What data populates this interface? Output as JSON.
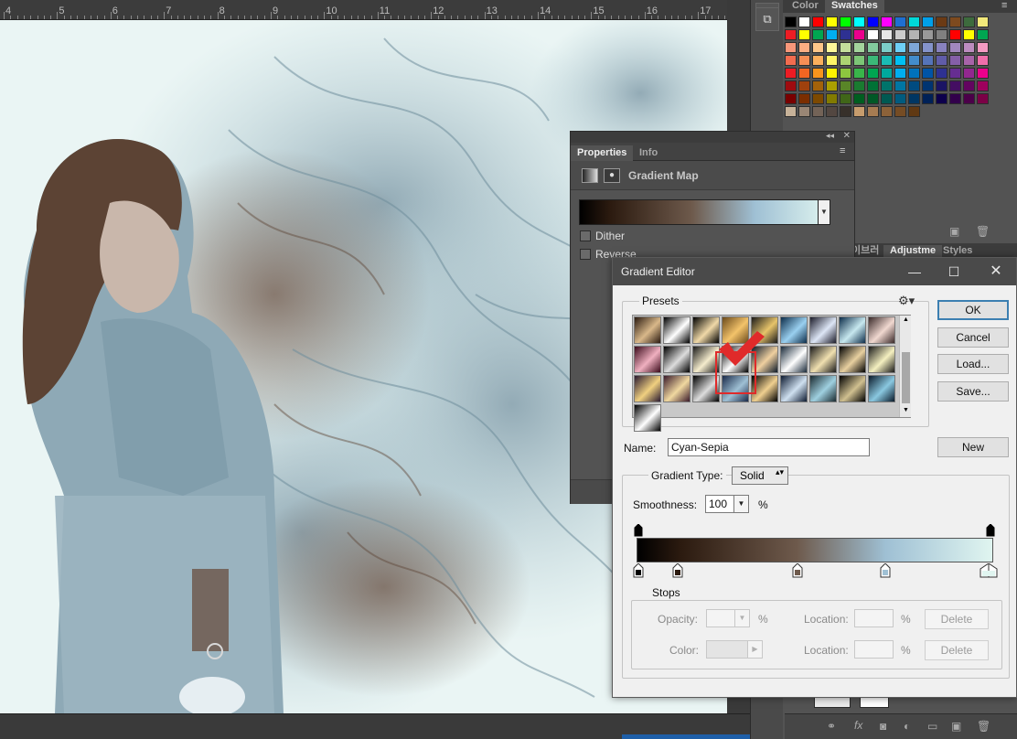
{
  "ruler": {
    "labels": [
      "4",
      "5",
      "6",
      "7",
      "8",
      "9",
      "10",
      "11",
      "12",
      "13",
      "14",
      "15",
      "16",
      "17"
    ]
  },
  "swatches_panel": {
    "tabs": [
      "Color",
      "Swatches"
    ],
    "colors": [
      "#000000",
      "#ffffff",
      "#ff0000",
      "#ffff00",
      "#00ff00",
      "#00ffff",
      "#0000ff",
      "#ff00ff",
      "#1f6fd1",
      "#00d8d8",
      "#00a0e9",
      "#6b3a14",
      "#7d4a1e",
      "#3d6b3d",
      "#f2e87a",
      "#ed1c24",
      "#ffff00",
      "#00a651",
      "#00aeef",
      "#2e3192",
      "#ec008c",
      "#ffffff",
      "#e6e6e6",
      "#cccccc",
      "#b3b3b3",
      "#999999",
      "#808080",
      "#ff0000",
      "#ffff00",
      "#00a651",
      "#f7977a",
      "#fbad82",
      "#fdc689",
      "#fff799",
      "#c4df9b",
      "#a3d39c",
      "#82ca9d",
      "#7bcdc8",
      "#6ecff6",
      "#7ea7d8",
      "#8493ca",
      "#8882be",
      "#a187be",
      "#bc8cbf",
      "#f49ac2",
      "#f26c4f",
      "#f68e55",
      "#fbaf5c",
      "#fff467",
      "#acd372",
      "#7cc576",
      "#3bb878",
      "#1abbb4",
      "#00bff3",
      "#438ccb",
      "#5574b9",
      "#605ca8",
      "#855fa8",
      "#a763a8",
      "#f06eaa",
      "#ed1c24",
      "#f26522",
      "#f7941d",
      "#fff200",
      "#8dc73f",
      "#39b54a",
      "#00a651",
      "#00a99d",
      "#00aeef",
      "#0072bc",
      "#0054a6",
      "#2e3192",
      "#662d91",
      "#92278f",
      "#ec008c",
      "#9e0b0f",
      "#a0410d",
      "#a3620a",
      "#aba000",
      "#598527",
      "#1a7b30",
      "#007236",
      "#00746b",
      "#0076a3",
      "#004b80",
      "#003471",
      "#1b1464",
      "#440e62",
      "#630460",
      "#9e005d",
      "#790000",
      "#7b2e00",
      "#7d4900",
      "#827b00",
      "#406618",
      "#005e20",
      "#005826",
      "#005952",
      "#005b7f",
      "#003663",
      "#002157",
      "#0d004c",
      "#32004b",
      "#4b0049",
      "#7b0046",
      "#c7b299",
      "#998675",
      "#736357",
      "#534741",
      "#37302a",
      "#c69c6d",
      "#a67c52",
      "#8c6239",
      "#754c24",
      "#603913"
    ]
  },
  "layers_panel": {
    "tabs": [
      "이브러",
      "Adjustme",
      "Styles"
    ]
  },
  "properties": {
    "tabs": [
      "Properties",
      "Info"
    ],
    "title": "Gradient Map",
    "dither_label": "Dither",
    "reverse_label": "Reverse"
  },
  "gradient_editor": {
    "title": "Gradient Editor",
    "presets_label": "Presets",
    "buttons": {
      "ok": "OK",
      "cancel": "Cancel",
      "load": "Load...",
      "save": "Save...",
      "new": "New"
    },
    "name_label": "Name:",
    "name_value": "Cyan-Sepia",
    "gradient_type_label": "Gradient Type:",
    "gradient_type_value": "Solid",
    "smoothness_label": "Smoothness:",
    "smoothness_value": "100",
    "percent": "%",
    "stops": {
      "label": "Stops",
      "opacity_label": "Opacity:",
      "color_label": "Color:",
      "location_label": "Location:",
      "delete_label": "Delete"
    },
    "gradient_colors": [
      "#000000",
      "#2b1a0f",
      "#6e5a4c",
      "#9fc0d4",
      "#e0f5f0"
    ],
    "preset_count": 28,
    "selected_preset_index": 21
  },
  "colors": {
    "accent_selection": "#e02a2a",
    "panel_bg": "#535353",
    "dialog_bg": "#f0f0f0"
  }
}
